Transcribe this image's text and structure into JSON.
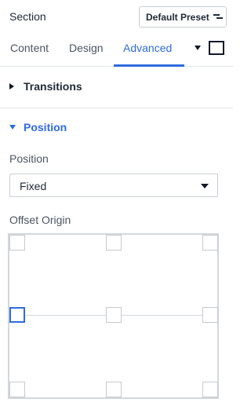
{
  "header": {
    "title": "Section",
    "preset_label": "Default Preset"
  },
  "tabs": [
    {
      "label": "Content"
    },
    {
      "label": "Design"
    },
    {
      "label": "Advanced",
      "active": true
    }
  ],
  "accent_color": "#2f6bdf",
  "sections": {
    "transitions": {
      "label": "Transitions",
      "expanded": false
    },
    "position": {
      "label": "Position",
      "expanded": true,
      "field_label": "Position",
      "select_value": "Fixed",
      "offset_label": "Offset Origin",
      "selected_origin": "middle-left"
    }
  }
}
